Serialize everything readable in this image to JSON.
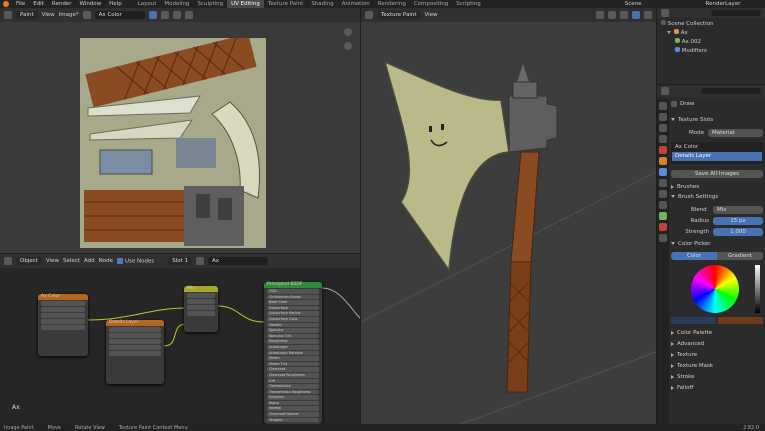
{
  "menu": [
    "File",
    "Edit",
    "Render",
    "Window",
    "Help"
  ],
  "workspaces": [
    "Layout",
    "Modeling",
    "Sculpting",
    "UV Editing",
    "Texture Paint",
    "Shading",
    "Animation",
    "Rendering",
    "Compositing",
    "Scripting"
  ],
  "active_workspace": "UV Editing",
  "scene": "Scene",
  "view_layer": "RenderLayer",
  "uv_header": {
    "mode": "Paint",
    "view": "View",
    "image": "Image*",
    "image_name": "Ax Color"
  },
  "node_header": {
    "type": "Object",
    "view": "View",
    "select": "Select",
    "add": "Add",
    "node": "Node",
    "use_nodes": "Use Nodes",
    "slot": "Slot 1",
    "material": "Ax"
  },
  "node_editor_label": "Ax",
  "nodes": {
    "ax_color": "Ax Color",
    "details_layer": "Details Layer",
    "mix": "Mix",
    "principled": "Principled BSDF",
    "principled_fields": [
      "GGX",
      "Christensen-Burley",
      "Base Color",
      "Subsurface",
      "Subsurface Radius",
      "Subsurface Color",
      "Metallic",
      "Specular",
      "Specular Tint",
      "Roughness",
      "Anisotropic",
      "Anisotropic Rotation",
      "Sheen",
      "Sheen Tint",
      "Clearcoat",
      "Clearcoat Roughness",
      "IOR",
      "Transmission",
      "Transmission Roughness",
      "Emission",
      "Alpha",
      "Normal",
      "Clearcoat Normal",
      "Tangent"
    ]
  },
  "viewport_header": {
    "mode": "Texture Paint",
    "view": "View"
  },
  "outliner": {
    "collection": "Scene Collection",
    "object": "Ax",
    "mesh": "Ax.002",
    "modifiers": "Modifiers"
  },
  "props": {
    "brush": "Draw",
    "texture_slots": "Texture Slots",
    "mode_label": "Mode",
    "mode_value": "Material",
    "slots": [
      "Ax Color",
      "Details Layer"
    ],
    "save_all": "Save All Images",
    "brushes": "Brushes",
    "brush_settings": "Brush Settings",
    "blend_label": "Blend",
    "blend_value": "Mix",
    "radius_label": "Radius",
    "radius_value": "15 px",
    "strength_label": "Strength",
    "strength_value": "1.000",
    "color_picker": "Color Picker",
    "color_tab": "Color",
    "gradient_tab": "Gradient",
    "sections": [
      "Color Palette",
      "Advanced",
      "Texture",
      "Texture Mask",
      "Stroke",
      "Falloff"
    ]
  },
  "status": {
    "left": "Image Paint",
    "move": "Move",
    "rotate": "Rotate View",
    "menu": "Texture Paint Context Menu",
    "version": "2.82.0"
  },
  "colors": {
    "accent": "#4772b3",
    "wood": "#8a4b22",
    "blade": "#b9b98a",
    "metal": "#5e5e5e"
  }
}
